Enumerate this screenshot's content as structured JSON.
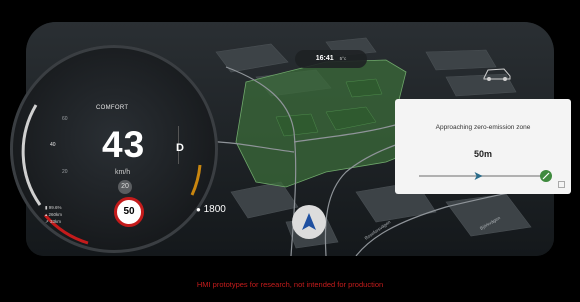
{
  "cluster": {
    "drive_mode": "COMFORT",
    "speed": "43",
    "speed_unit": "km/h",
    "gear": "D",
    "scale_labels": [
      "60",
      "40",
      "20"
    ],
    "current_speed_limit_marker": "20",
    "speed_limit": "50",
    "battery_pct": "99.6%",
    "stat_line_1": "260km",
    "stat_line_2": "33km",
    "range_value": "1800"
  },
  "status": {
    "time": "16:41",
    "temperature": "5°c"
  },
  "notification": {
    "title": "Approaching zero-emission zone",
    "distance": "50m",
    "progress_fraction": 0.48
  },
  "map": {
    "street_label_1": "Roseforsvägen",
    "street_label_2": "Björkvägen"
  },
  "footer": {
    "disclaimer": "HMI prototypes for research, not intended for production"
  },
  "colors": {
    "zone_fill": "#3b6b3a",
    "accent_green": "#3f8a3e",
    "limit_red": "#c41b1b",
    "footer_red": "#c61c1c"
  }
}
